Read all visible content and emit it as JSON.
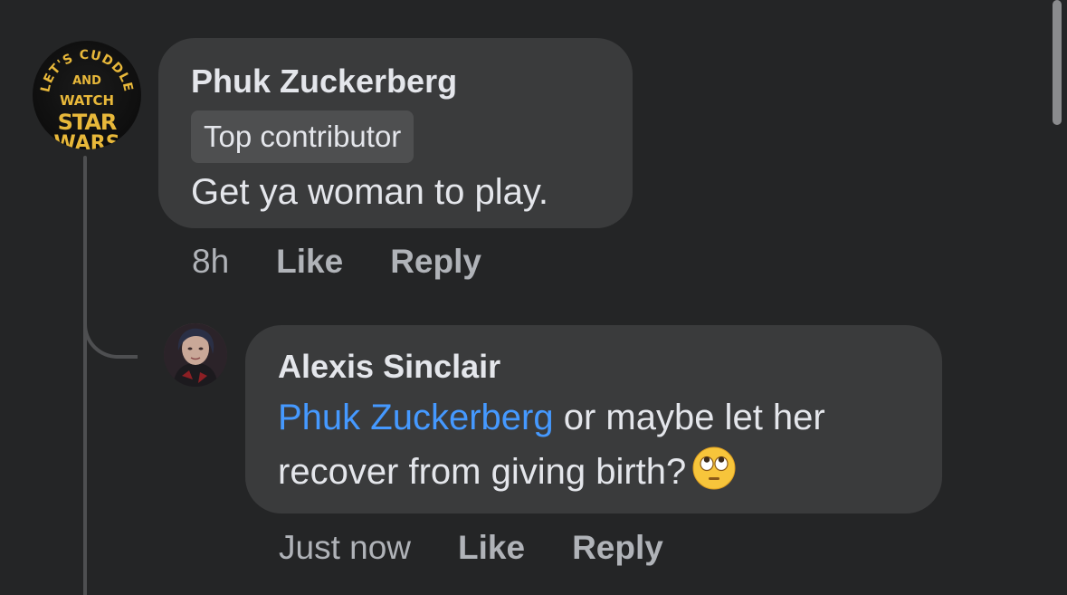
{
  "thread": {
    "comment": {
      "author": "Phuk Zuckerberg",
      "badge": "Top contributor",
      "text": "Get ya woman to play.",
      "time": "8h",
      "like_label": "Like",
      "reply_label": "Reply",
      "avatar_text": [
        "LET'S CUDDLE",
        "AND",
        "WATCH",
        "STAR",
        "WARS"
      ]
    },
    "reply": {
      "author": "Alexis Sinclair",
      "mention": "Phuk Zuckerberg",
      "text": " or maybe let her recover from giving birth?",
      "emoji": "face-with-rolling-eyes-icon",
      "time": "Just now",
      "like_label": "Like",
      "reply_label": "Reply"
    }
  },
  "colors": {
    "background": "#242526",
    "bubble": "#3a3b3c",
    "mention": "#4599ff",
    "secondary_text": "#b0b3b8"
  }
}
